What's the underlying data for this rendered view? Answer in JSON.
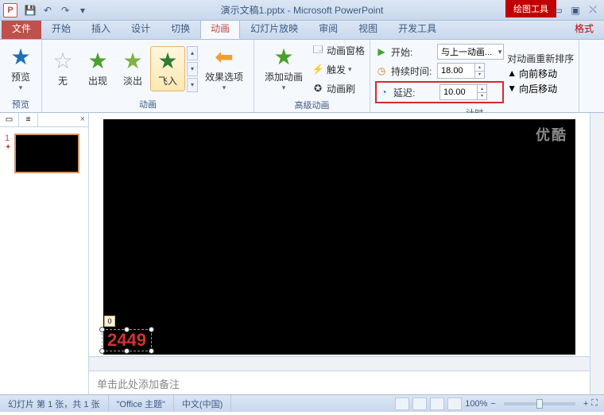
{
  "title": "演示文稿1.pptx - Microsoft PowerPoint",
  "context_tab": "绘图工具",
  "tabs": {
    "file": "文件",
    "items": [
      "开始",
      "插入",
      "设计",
      "切换",
      "动画",
      "幻灯片放映",
      "审阅",
      "视图",
      "开发工具"
    ],
    "format": "格式",
    "active": "动画"
  },
  "ribbon": {
    "preview": {
      "label": "预览",
      "group": "预览"
    },
    "anims": {
      "none": "无",
      "appear": "出现",
      "fade": "淡出",
      "flyin": "飞入",
      "group": "动画"
    },
    "effect_options": "效果选项",
    "advanced": {
      "add": "添加动画",
      "pane": "动画窗格",
      "trigger": "触发",
      "painter": "动画刷",
      "group": "高级动画"
    },
    "timing": {
      "start_label": "开始:",
      "start_value": "与上一动画...",
      "duration_label": "持续时间:",
      "duration_value": "18.00",
      "delay_label": "延迟:",
      "delay_value": "10.00",
      "group": "计时"
    },
    "reorder": {
      "header": "对动画重新排序",
      "earlier": "向前移动",
      "later": "向后移动"
    }
  },
  "thumb": {
    "num": "1",
    "anim_indicator": "✦"
  },
  "slide": {
    "watermark": "优酷",
    "text": "2449",
    "anim_tag": "0"
  },
  "notes_placeholder": "单击此处添加备注",
  "status": {
    "slide_info": "幻灯片 第 1 张，共 1 张",
    "theme": "\"Office 主题\"",
    "lang": "中文(中国)",
    "zoom": "100%"
  }
}
